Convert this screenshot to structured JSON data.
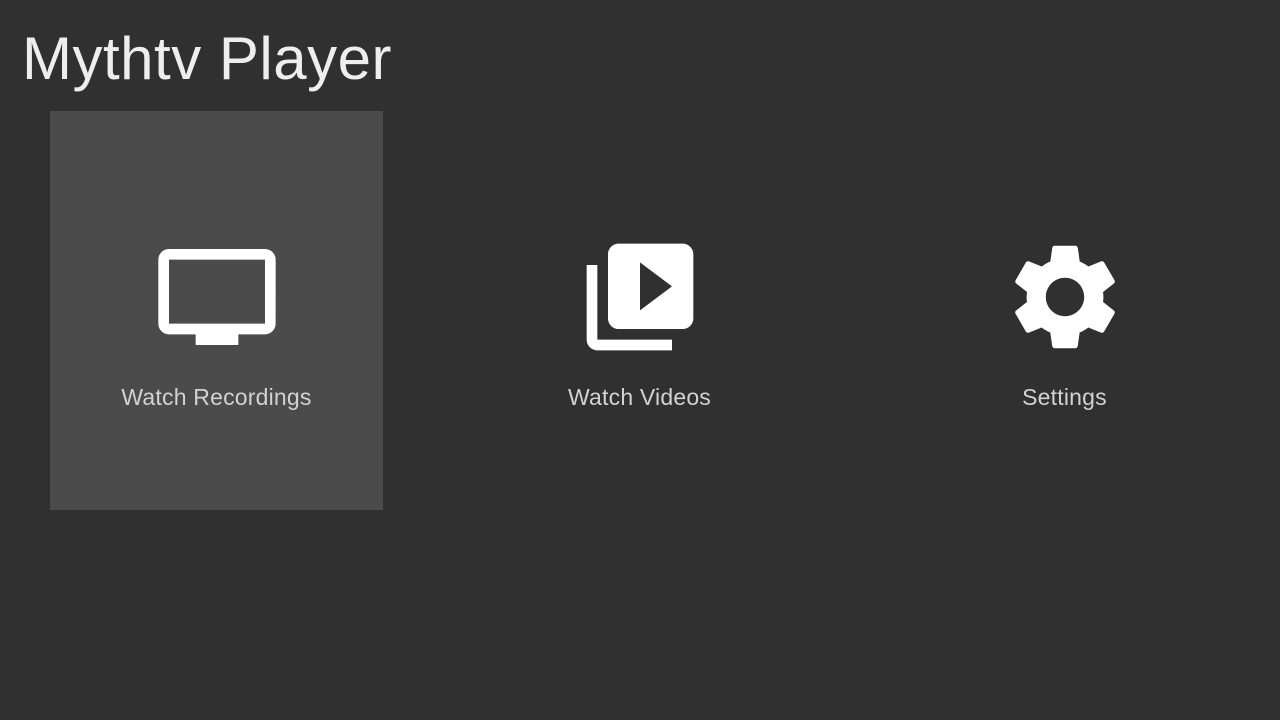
{
  "app": {
    "title": "Mythtv Player"
  },
  "menu": {
    "items": [
      {
        "label": "Watch Recordings",
        "icon": "tv-icon",
        "selected": true
      },
      {
        "label": "Watch Videos",
        "icon": "video-library-icon",
        "selected": false
      },
      {
        "label": "Settings",
        "icon": "gear-icon",
        "selected": false
      }
    ]
  },
  "colors": {
    "background": "#303030",
    "selected_tile": "#4b4b4b",
    "icon": "#ffffff",
    "label": "#d2d2d2"
  }
}
